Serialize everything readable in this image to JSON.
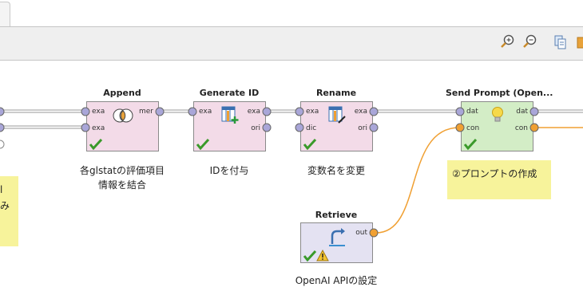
{
  "toolbar": {
    "zoom_in_icon": "magnifier-plus-icon",
    "zoom_out_icon": "magnifier-minus-icon",
    "copy_icon": "copy-icon",
    "folder_icon": "folder-icon"
  },
  "colors": {
    "op_pink": "#f3dbe8",
    "op_green": "#d3edc6",
    "op_purple": "#e4e2f2",
    "port_purple": "#a9a6d8",
    "port_orange": "#f0a033",
    "wire": "#9a9a9a",
    "wire_orange": "#f0a033",
    "note_yellow": "#f7f39b"
  },
  "operators": [
    {
      "id": "append",
      "title": "Append",
      "ports_in": [
        "exa",
        "exa"
      ],
      "ports_out": [
        "mer"
      ],
      "caption_lines": [
        "各glstatの評価項目",
        "情報を結合"
      ]
    },
    {
      "id": "generate-id",
      "title": "Generate ID",
      "ports_in": [
        "exa"
      ],
      "ports_out": [
        "exa",
        "ori"
      ],
      "caption_lines": [
        "IDを付与"
      ]
    },
    {
      "id": "rename",
      "title": "Rename",
      "ports_in": [
        "exa",
        "dic"
      ],
      "ports_out": [
        "exa",
        "ori"
      ],
      "caption_lines": [
        "変数名を変更"
      ]
    },
    {
      "id": "send-prompt",
      "title": "Send Prompt (Open...",
      "ports_in": [
        "dat",
        "con"
      ],
      "ports_out": [
        "dat",
        "con"
      ],
      "caption_lines": []
    },
    {
      "id": "retrieve",
      "title": "Retrieve",
      "ports_in": [],
      "ports_out": [
        "out"
      ],
      "caption_lines": [
        "OpenAI APIの設定"
      ]
    }
  ],
  "notes": [
    {
      "id": "note-left",
      "lines": [
        "l",
        "み"
      ]
    },
    {
      "id": "note-prompt",
      "lines": [
        "②プロンプトの作成"
      ]
    }
  ]
}
